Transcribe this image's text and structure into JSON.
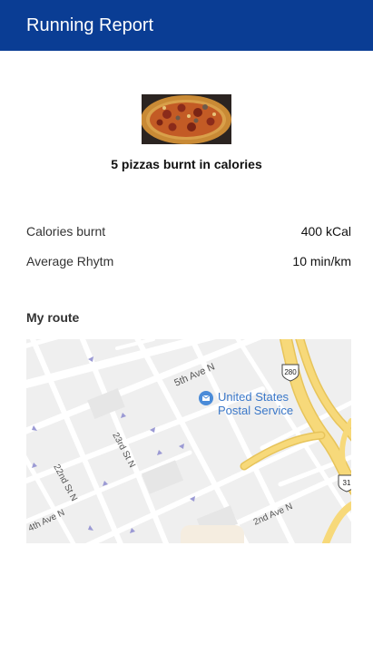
{
  "app": {
    "title": "Running Report"
  },
  "summary": {
    "pizza_image": "pizza-image",
    "caption": "5 pizzas burnt in calories"
  },
  "stats": [
    {
      "label": "Calories burnt",
      "value": "400 kCal"
    },
    {
      "label": "Average Rhytm",
      "value": "10 min/km"
    }
  ],
  "route": {
    "title": "My route",
    "map": {
      "poi": [
        "United States",
        "Postal Service"
      ],
      "streets": [
        "5th Ave N",
        "23rd St N",
        "22nd St N",
        "4th Ave N",
        "2nd Ave N"
      ],
      "shields": [
        "280",
        "31"
      ],
      "colors": {
        "highway": "#f7d97a",
        "road": "#ffffff",
        "land": "#efefef",
        "poi": "#4a8bd8"
      }
    }
  }
}
